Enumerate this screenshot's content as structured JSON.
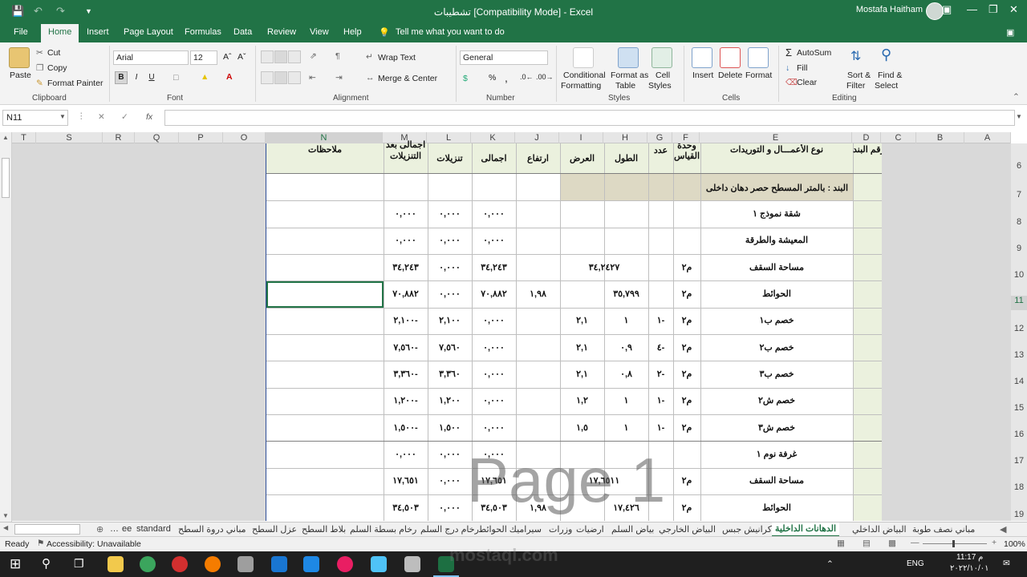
{
  "titlebar": {
    "title": "تشطيبات  [Compatibility Mode]  -  Excel",
    "user": "Mostafa Haitham"
  },
  "tabs": [
    "File",
    "Home",
    "Insert",
    "Page Layout",
    "Formulas",
    "Data",
    "Review",
    "View",
    "Help"
  ],
  "tell_me": "Tell me what you want to do",
  "ribbon": {
    "clipboard": {
      "paste": "Paste",
      "cut": "Cut",
      "copy": "Copy",
      "format_painter": "Format Painter",
      "label": "Clipboard"
    },
    "font": {
      "name": "Arial",
      "size": "12",
      "label": "Font",
      "bold": "B",
      "italic": "I",
      "underline": "U"
    },
    "alignment": {
      "wrap": "Wrap Text",
      "merge": "Merge & Center",
      "label": "Alignment"
    },
    "number": {
      "format": "General",
      "label": "Number",
      "percent": "%",
      "comma": ","
    },
    "styles": {
      "conditional": "Conditional",
      "conditional2": "Formatting",
      "format_as": "Format as",
      "format_as2": "Table",
      "cell_styles": "Cell",
      "cell_styles2": "Styles",
      "label": "Styles"
    },
    "cells": {
      "insert": "Insert",
      "delete": "Delete",
      "format": "Format",
      "label": "Cells"
    },
    "editing": {
      "autosum": "AutoSum",
      "fill": "Fill",
      "clear": "Clear",
      "sort": "Sort &",
      "sort2": "Filter",
      "find": "Find &",
      "find2": "Select",
      "label": "Editing"
    }
  },
  "formula_bar": {
    "name_box": "N11",
    "fx": "fx",
    "value": ""
  },
  "columns": [
    "T",
    "S",
    "R",
    "Q",
    "P",
    "O",
    "N",
    "M",
    "L",
    "K",
    "J",
    "I",
    "H",
    "G",
    "F",
    "E",
    "D",
    "C",
    "B",
    "A"
  ],
  "rows": [
    "6",
    "7",
    "8",
    "9",
    "10",
    "11",
    "12",
    "13",
    "14",
    "15",
    "16",
    "17",
    "18",
    "19"
  ],
  "headers": {
    "N": "ملاحظات",
    "M1": "اجمالى بعد",
    "M2": "التنزيلات",
    "L": "تنزيلات",
    "K": "اجمالى",
    "J": "ارتفاع",
    "I": "العرض",
    "H": "الطول",
    "G": "عدد",
    "F1": "وحدة",
    "F2": "القياس",
    "E": "نوع الأعمـــال و التوريدات",
    "D": "رقم البند"
  },
  "section_title": "البند : بالمتر المسطح حصر دهان داخلى",
  "data_rows": [
    {
      "row": "8",
      "E": "شقة نموذج ١",
      "F": "",
      "G": "",
      "H": "",
      "I": "",
      "J": "",
      "K": "٠,٠٠٠",
      "L": "٠,٠٠٠",
      "M": "٠,٠٠٠"
    },
    {
      "row": "9",
      "E": "المعيشة والطرقة",
      "F": "",
      "G": "",
      "H": "",
      "I": "",
      "J": "",
      "K": "٠,٠٠٠",
      "L": "٠,٠٠٠",
      "M": "٠,٠٠٠"
    },
    {
      "row": "10",
      "E": "مساحة السقف",
      "F": "م٢",
      "G": "",
      "H": "٣٤,٢٤٢٧",
      "I": "",
      "J": "",
      "K": "٣٤,٢٤٣",
      "L": "٠,٠٠٠",
      "M": "٣٤,٢٤٣"
    },
    {
      "row": "11",
      "E": "الحوائط",
      "F": "م٢",
      "G": "",
      "H": "٣٥,٧٩٩",
      "I": "",
      "J": "١,٩٨",
      "K": "٧٠,٨٨٢",
      "L": "٠,٠٠٠",
      "M": "٧٠,٨٨٢"
    },
    {
      "row": "12",
      "E": "خصم ب١",
      "F": "م٢",
      "G": "١-",
      "H": "١",
      "I": "٢,١",
      "J": "",
      "K": "٠,٠٠٠",
      "L": "٢,١٠٠",
      "M": "٢,١٠٠-"
    },
    {
      "row": "13",
      "E": "خصم ب٢",
      "F": "م٢",
      "G": "٤-",
      "H": "٠,٩",
      "I": "٢,١",
      "J": "",
      "K": "٠,٠٠٠",
      "L": "٧,٥٦٠",
      "M": "٧,٥٦٠-"
    },
    {
      "row": "14",
      "E": "خصم ب٣",
      "F": "م٢",
      "G": "٢-",
      "H": "٠,٨",
      "I": "٢,١",
      "J": "",
      "K": "٠,٠٠٠",
      "L": "٣,٣٦٠",
      "M": "٣,٣٦٠-"
    },
    {
      "row": "15",
      "E": "خصم ش٢",
      "F": "م٢",
      "G": "١-",
      "H": "١",
      "I": "١,٢",
      "J": "",
      "K": "٠,٠٠٠",
      "L": "١,٢٠٠",
      "M": "١,٢٠٠-"
    },
    {
      "row": "16",
      "E": "خصم ش٣",
      "F": "م٢",
      "G": "١-",
      "H": "١",
      "I": "١,٥",
      "J": "",
      "K": "٠,٠٠٠",
      "L": "١,٥٠٠",
      "M": "١,٥٠٠-"
    },
    {
      "row": "17",
      "E": "غرفة نوم ١",
      "F": "",
      "G": "",
      "H": "",
      "I": "",
      "J": "",
      "K": "٠,٠٠٠",
      "L": "٠,٠٠٠",
      "M": "٠,٠٠٠"
    },
    {
      "row": "18",
      "E": "مساحة السقف",
      "F": "م٢",
      "G": "",
      "H": "١٧,٦٥١١",
      "I": "",
      "J": "",
      "K": "١٧,٦٥١",
      "L": "٠,٠٠٠",
      "M": "١٧,٦٥١"
    },
    {
      "row": "19",
      "E": "الحوائط",
      "F": "م٢",
      "G": "",
      "H": "١٧,٤٢٦",
      "I": "",
      "J": "١,٩٨",
      "K": "٣٤,٥٠٣",
      "L": "٠,٠٠٠",
      "M": "٣٤,٥٠٣"
    }
  ],
  "watermark": "Page 1",
  "sheet_tabs": [
    "مباني نصف طوبة",
    "البياض الداخلي",
    "الدهانات الداخلية",
    "كرانيش جبس",
    "البياض الخارجي",
    "بياض السلم",
    "ارضيات",
    "وزرات",
    "سيراميك الحوائط",
    "رخام درج السلم",
    "رخام بسطة السلم",
    "بلاط السطح",
    "عزل السطح",
    "مباني دروة السطح",
    "standard",
    "ee"
  ],
  "active_sheet": "الدهانات الداخلية",
  "status": {
    "ready": "Ready",
    "accessibility": "Accessibility: Unavailable",
    "zoom": "100%"
  },
  "taskbar": {
    "lang": "ENG",
    "time": "11:17 م",
    "date": "٢٠٢٢/١٠/٠١"
  },
  "site_watermark": "mostaql.com"
}
